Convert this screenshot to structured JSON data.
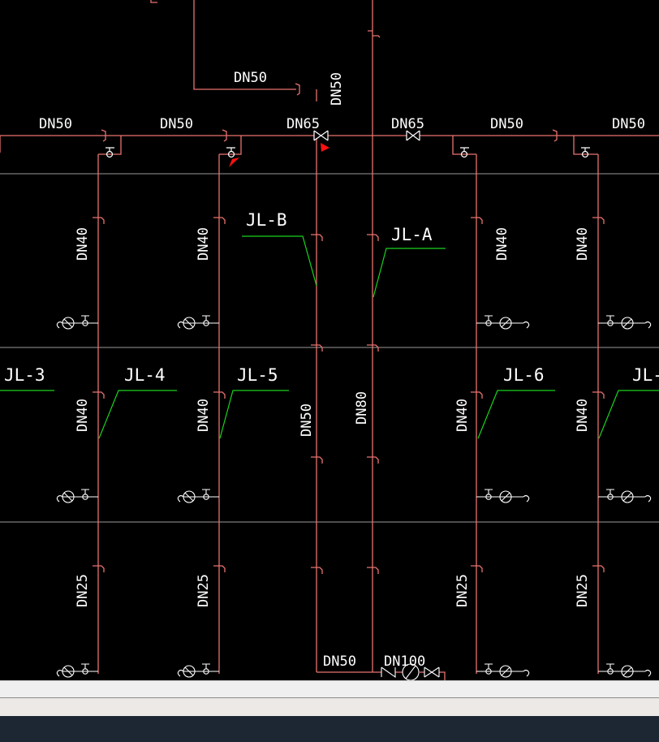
{
  "colors": {
    "background": "#000000",
    "pipe": "#e8736f",
    "leader": "#19d21e",
    "text": "#ffffff",
    "grid": "#9a9a9a",
    "cursor": "#ff1010"
  },
  "pipe_labels": {
    "top_branch": "DN50",
    "top_riser": "DN50",
    "main_1": "DN50",
    "main_2": "DN50",
    "main_3": "DN65",
    "main_4": "DN65",
    "main_5": "DN50",
    "main_6": "DN50",
    "riser1_upper": "DN40",
    "riser2_upper": "DN40",
    "riser5_upper": "DN40",
    "riser6_upper": "DN40",
    "riser1_mid": "DN40",
    "riser2_mid": "DN40",
    "riser3_mid": "DN50",
    "riser4_mid": "DN80",
    "riser5_mid": "DN40",
    "riser6_mid": "DN40",
    "riser1_low": "DN25",
    "riser2_low": "DN25",
    "riser5_low": "DN25",
    "riser6_low": "DN25",
    "bottom_1": "DN50",
    "bottom_2": "DN100"
  },
  "riser_tags": {
    "jl_b": "JL-B",
    "jl_a": "JL-A",
    "jl_3": "JL-3",
    "jl_4": "JL-4",
    "jl_5": "JL-5",
    "jl_6": "JL-6",
    "jl_7": "JL-"
  },
  "fixture_icons": [
    "water-meter-icon",
    "valve-icon"
  ]
}
